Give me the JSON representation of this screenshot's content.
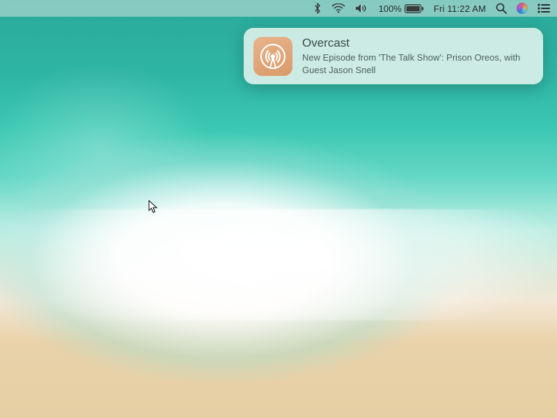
{
  "menubar": {
    "bluetooth_icon": "bluetooth",
    "wifi_icon": "wifi",
    "volume_icon": "volume",
    "battery_percent": "100%",
    "battery_icon": "battery-full",
    "clock_text": "Fri 11:22 AM",
    "search_icon": "search",
    "siri_icon": "siri",
    "notification_center_icon": "list"
  },
  "notification": {
    "app_name": "Overcast",
    "app_icon": "overcast",
    "title": "Overcast",
    "body": "New Episode from 'The Talk Show': Prison Oreos, with Guest Jason Snell"
  },
  "wallpaper": "aerial-beach-waves"
}
